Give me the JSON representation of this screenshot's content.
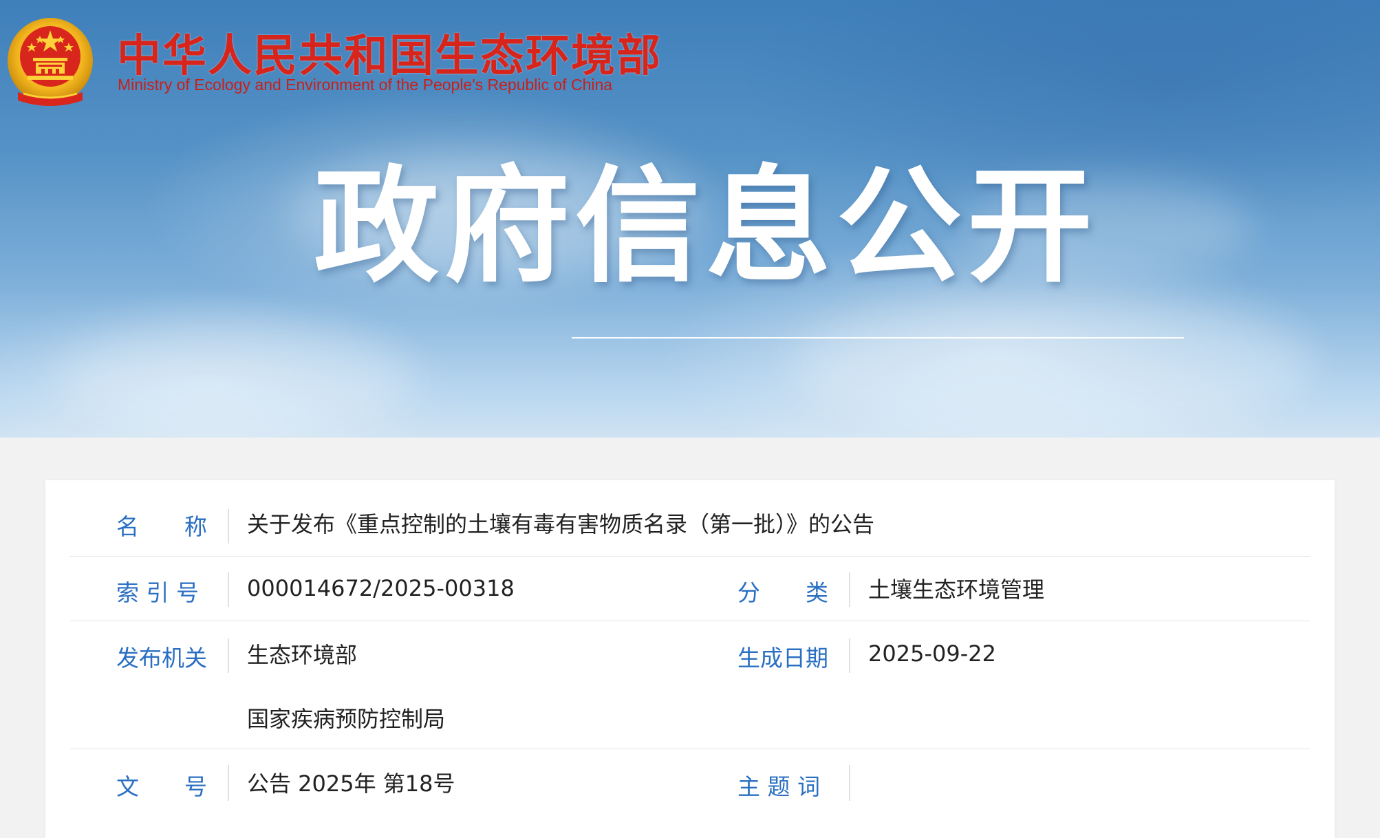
{
  "header": {
    "site_title_cn": "中华人民共和国生态环境部",
    "site_title_en": "Ministry of Ecology and Environment of the People's Republic of China",
    "emblem_icon": "national-emblem-icon"
  },
  "banner": {
    "heading": "政府信息公开"
  },
  "colors": {
    "brand_red": "#d8251c",
    "label_blue": "#2a6fc2",
    "text": "#222222"
  },
  "info": {
    "name": {
      "label": "名    称",
      "value": "关于发布《重点控制的土壤有毒有害物质名录（第一批）》的公告"
    },
    "index_no": {
      "label": "索 引 号",
      "value": "000014672/2025-00318"
    },
    "category": {
      "label": "分    类",
      "value": "土壤生态环境管理"
    },
    "issuer": {
      "label": "发布机关",
      "values": [
        "生态环境部",
        "国家疾病预防控制局"
      ]
    },
    "date": {
      "label": "生成日期",
      "value": "2025-09-22"
    },
    "doc_no": {
      "label": "文    号",
      "value": "公告 2025年 第18号"
    },
    "keywords": {
      "label": "主 题 词",
      "value": ""
    }
  }
}
